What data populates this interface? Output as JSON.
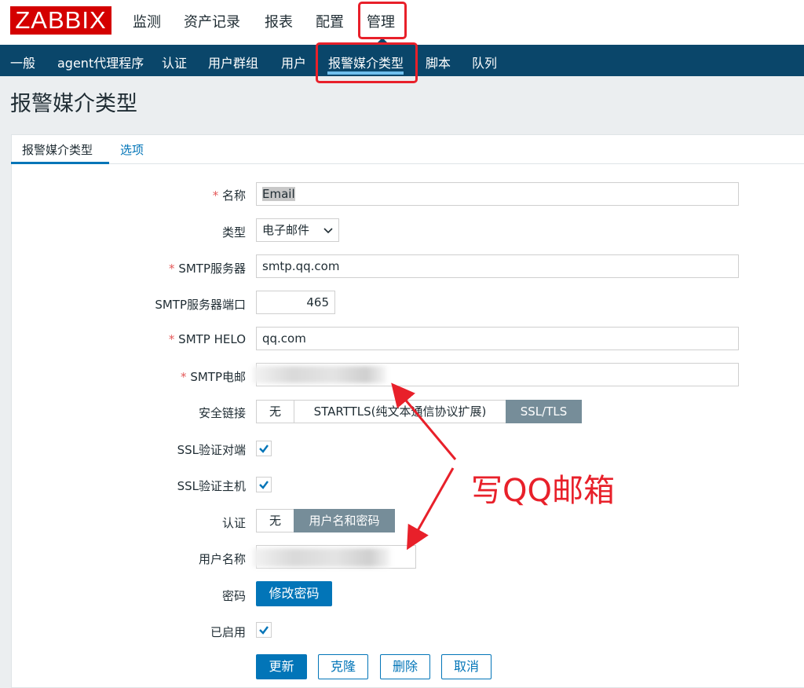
{
  "header": {
    "logo": "ZABBIX",
    "menu": [
      "监测",
      "资产记录",
      "报表",
      "配置",
      "管理"
    ]
  },
  "submenu": [
    "一般",
    "agent代理程序",
    "认证",
    "用户群组",
    "用户",
    "报警媒介类型",
    "脚本",
    "队列"
  ],
  "page_title": "报警媒介类型",
  "tabs": [
    "报警媒介类型",
    "选项"
  ],
  "form": {
    "name_label": "名称",
    "name_value": "Email",
    "type_label": "类型",
    "type_value": "电子邮件",
    "smtp_server_label": "SMTP服务器",
    "smtp_server_value": "smtp.qq.com",
    "smtp_port_label": "SMTP服务器端口",
    "smtp_port_value": "465",
    "smtp_helo_label": "SMTP HELO",
    "smtp_helo_value": "qq.com",
    "smtp_email_label": "SMTP电邮",
    "security_label": "安全链接",
    "security_options": [
      "无",
      "STARTTLS(纯文本通信协议扩展)",
      "SSL/TLS"
    ],
    "ssl_peer_label": "SSL验证对端",
    "ssl_host_label": "SSL验证主机",
    "auth_label": "认证",
    "auth_options": [
      "无",
      "用户名和密码"
    ],
    "username_label": "用户名称",
    "password_label": "密码",
    "change_password": "修改密码",
    "enabled_label": "已启用",
    "required_mark": "*"
  },
  "buttons": {
    "update": "更新",
    "clone": "克隆",
    "delete": "删除",
    "cancel": "取消"
  },
  "annotation": "写QQ邮箱",
  "colors": {
    "brand_red": "#d40000",
    "subnav_bg": "#0a466a",
    "primary_blue": "#0275b8",
    "highlight_red": "#e8202a",
    "segment_active": "#768d99"
  }
}
